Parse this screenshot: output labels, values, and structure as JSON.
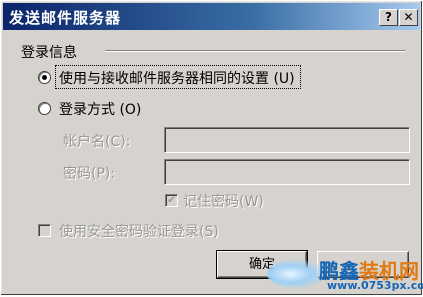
{
  "window": {
    "title": "发送邮件服务器",
    "help_label": "?",
    "close_label": "✕"
  },
  "group": {
    "label": "登录信息"
  },
  "options": {
    "same_settings": {
      "label": "使用与接收邮件服务器相同的设置",
      "key": "(U)",
      "selected": true
    },
    "login_with": {
      "label": "登录方式",
      "key": "(O)",
      "selected": false
    }
  },
  "fields": {
    "account": {
      "label": "帐户名",
      "key": "(C)",
      "suffix": ":",
      "value": ""
    },
    "password": {
      "label": "密码",
      "key": "(P)",
      "suffix": ":",
      "value": ""
    }
  },
  "remember_password": {
    "label": "记住密码",
    "key": "(W)",
    "checked": true,
    "enabled": false
  },
  "secure_auth": {
    "label": "使用安全密码验证登录",
    "key": "(S)",
    "checked": false,
    "enabled": false
  },
  "buttons": {
    "ok": "确定",
    "cancel": ""
  },
  "watermark": {
    "brand_part1": "鹏鑫",
    "brand_part2": "装机网",
    "url": "www.0753px.com"
  },
  "colors": {
    "title_start": "#0a246a",
    "title_end": "#a6caf0",
    "face": "#d6d3ce",
    "disabled_text": "#9a9894",
    "brand_blue": "#1666b3",
    "brand_orange": "#e07a12"
  }
}
